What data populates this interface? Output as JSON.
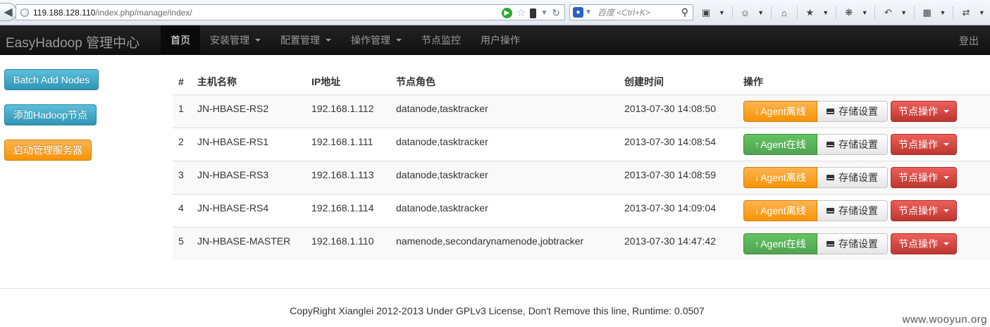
{
  "browser": {
    "url_host": "119.188.128.110",
    "url_path": "/index.php/manage/index/",
    "search_placeholder": "百度 <Ctrl+K>"
  },
  "navbar": {
    "brand": "EasyHadoop 管理中心",
    "items": [
      {
        "label": "首页",
        "active": true,
        "dropdown": false
      },
      {
        "label": "安装管理",
        "active": false,
        "dropdown": true
      },
      {
        "label": "配置管理",
        "active": false,
        "dropdown": true
      },
      {
        "label": "操作管理",
        "active": false,
        "dropdown": true
      },
      {
        "label": "节点监控",
        "active": false,
        "dropdown": false
      },
      {
        "label": "用户操作",
        "active": false,
        "dropdown": false
      }
    ],
    "logout": "登出"
  },
  "sidebar": {
    "buttons": [
      {
        "label": "Batch Add Nodes",
        "style": "info"
      },
      {
        "label": "添加Hadoop节点",
        "style": "info"
      },
      {
        "label": "启动管理服务器",
        "style": "warning"
      }
    ]
  },
  "table": {
    "headers": [
      "#",
      "主机名称",
      "IP地址",
      "节点角色",
      "创建时间",
      "操作"
    ],
    "rows": [
      {
        "num": "1",
        "host": "JN-HBASE-RS2",
        "ip": "192.168.1.112",
        "role": "datanode,tasktracker",
        "created": "2013-07-30 14:08:50",
        "agent_label": "Agent离线",
        "agent_status": "offline"
      },
      {
        "num": "2",
        "host": "JN-HBASE-RS1",
        "ip": "192.168.1.111",
        "role": "datanode,tasktracker",
        "created": "2013-07-30 14:08:54",
        "agent_label": "Agent在线",
        "agent_status": "online"
      },
      {
        "num": "3",
        "host": "JN-HBASE-RS3",
        "ip": "192.168.1.113",
        "role": "datanode,tasktracker",
        "created": "2013-07-30 14:08:59",
        "agent_label": "Agent离线",
        "agent_status": "offline"
      },
      {
        "num": "4",
        "host": "JN-HBASE-RS4",
        "ip": "192.168.1.114",
        "role": "datanode,tasktracker",
        "created": "2013-07-30 14:09:04",
        "agent_label": "Agent离线",
        "agent_status": "offline"
      },
      {
        "num": "5",
        "host": "JN-HBASE-MASTER",
        "ip": "192.168.1.110",
        "role": "namenode,secondarynamenode,jobtracker",
        "created": "2013-07-30 14:47:42",
        "agent_label": "Agent在线",
        "agent_status": "online"
      }
    ],
    "storage_label": "存储设置",
    "node_ops_label": "节点操作"
  },
  "footer": {
    "text": "CopyRight Xianglei 2012-2013 Under GPLv3 License, Don't Remove this line, Runtime: 0.0507"
  },
  "watermark": "www.wooyun.org",
  "colors": {
    "navbar_bg": "#1b1b1b",
    "info": "#49afcd",
    "warning": "#faa732",
    "success": "#5bb75b",
    "danger": "#da4f49"
  }
}
